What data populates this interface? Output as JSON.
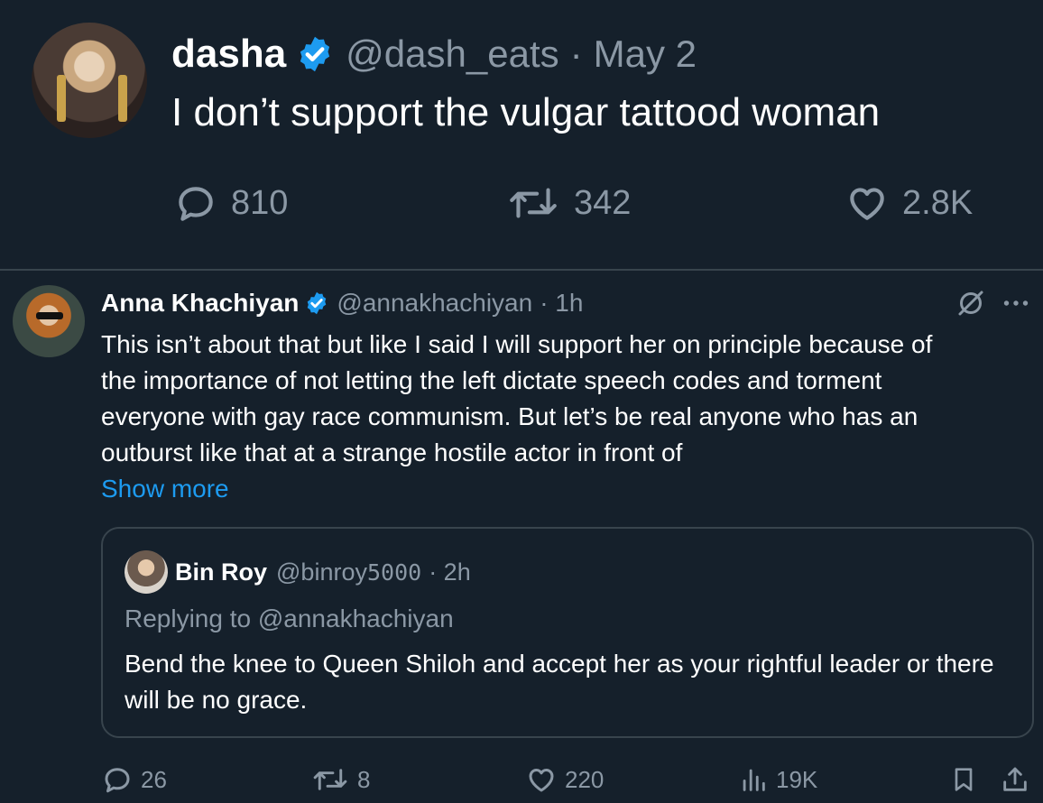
{
  "main_tweet": {
    "author_name": "dasha",
    "handle": "@dash_eats",
    "separator": "·",
    "date": "May 2",
    "text": "I don’t support the vulgar tattood woman",
    "stats": {
      "replies": "810",
      "retweets": "342",
      "likes": "2.8K"
    }
  },
  "reply_tweet": {
    "author_name": "Anna Khachiyan",
    "handle": "@annakhachiyan",
    "time": "· 1h",
    "text_lines": [
      "This isn’t about that but like I said I will support her on principle because of",
      "the importance of not letting the left dictate speech codes and torment",
      "everyone with gay race communism. But let’s be real anyone who has an",
      "outburst like that at a strange hostile actor in front of"
    ],
    "show_more": "Show more",
    "quoted": {
      "author_name": "Bin Roy",
      "handle_prefix": "@binroy",
      "handle_digits": "5000",
      "time": "· 2h",
      "replying_to": "Replying to @annakhachiyan",
      "text": "Bend the knee to Queen Shiloh and accept her as your rightful leader or there will be no grace."
    },
    "actions": {
      "replies": "26",
      "retweets": "8",
      "likes": "220",
      "views": "19K"
    }
  },
  "colors": {
    "background": "#15202b",
    "text": "#ffffff",
    "muted": "#8b98a5",
    "accent": "#1d9bf0",
    "border": "#38444d"
  },
  "icons": [
    "verified-badge-icon",
    "reply-icon",
    "retweet-icon",
    "like-icon",
    "grok-icon",
    "more-icon",
    "views-icon",
    "bookmark-icon",
    "share-icon"
  ]
}
